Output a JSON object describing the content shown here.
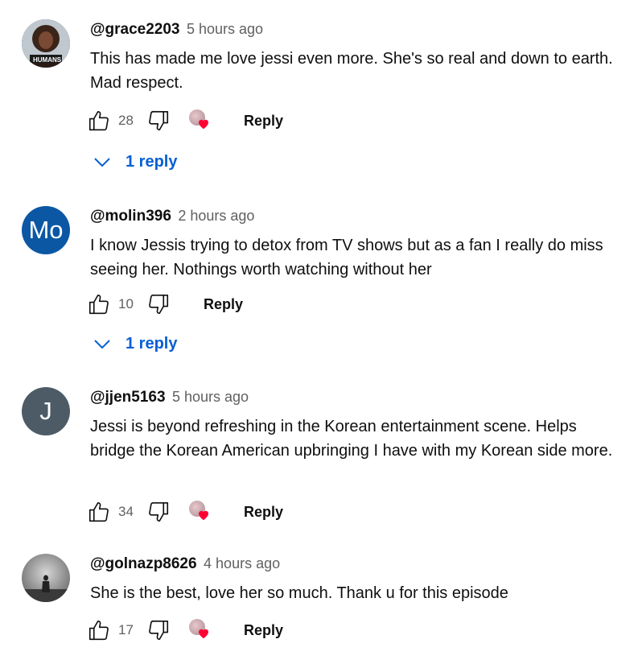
{
  "comments": [
    {
      "handle": "@grace2203",
      "time": "5 hours ago",
      "text": "This has made me love jessi even more. She's so real and down to earth. Mad respect.",
      "likes": "28",
      "avatar_label": "HUMANS",
      "avatar_color": "#2b2b2b",
      "creator_heart": true,
      "reply_label": "Reply",
      "replies_label": "1 reply"
    },
    {
      "handle": "@molin396",
      "time": "2 hours ago",
      "text": "I know Jessis trying to detox from TV shows but as a fan I really do miss seeing her. Nothings worth watching without her",
      "likes": "10",
      "avatar_initials": "Mo",
      "avatar_color": "#0b57a4",
      "creator_heart": false,
      "reply_label": "Reply",
      "replies_label": "1 reply"
    },
    {
      "handle": "@jjen5163",
      "time": "5 hours ago",
      "text": "Jessi is beyond refreshing in the Korean entertainment scene. Helps bridge the Korean American upbringing I have with my Korean side more.",
      "likes": "34",
      "avatar_initials": "J",
      "avatar_color": "#4c5b66",
      "creator_heart": true,
      "reply_label": "Reply"
    },
    {
      "handle": "@golnazp8626",
      "time": "4 hours ago",
      "text": "She is the best, love her so much. Thank u for this episode",
      "likes": "17",
      "avatar_color": "#8a8a8a",
      "creator_heart": true,
      "reply_label": "Reply"
    }
  ],
  "colors": {
    "link_blue": "#065fd4",
    "secondary_text": "#606060",
    "heart_red": "#ff0033"
  }
}
